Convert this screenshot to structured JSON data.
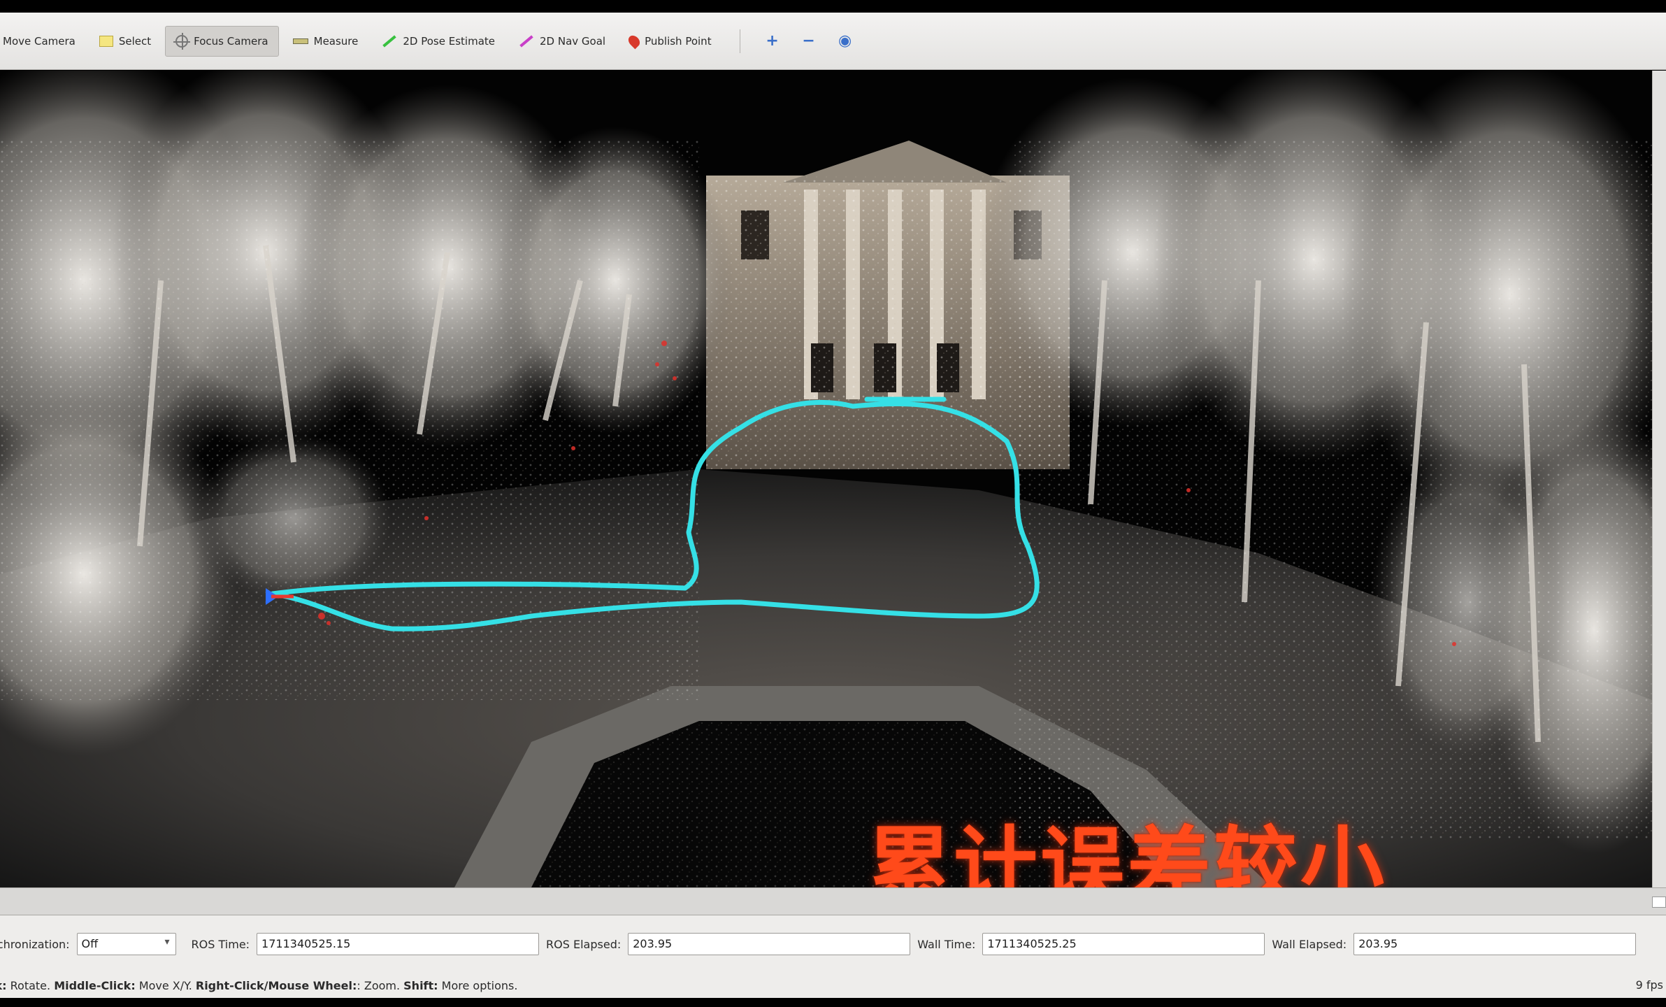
{
  "toolbar": {
    "tools": [
      {
        "label": "Move Camera",
        "icon": "move-camera-icon"
      },
      {
        "label": "Select",
        "icon": "select-icon"
      },
      {
        "label": "Focus Camera",
        "icon": "focus-camera-icon",
        "active": true
      },
      {
        "label": "Measure",
        "icon": "measure-icon"
      },
      {
        "label": "2D Pose Estimate",
        "icon": "pose-arrow-icon"
      },
      {
        "label": "2D Nav Goal",
        "icon": "nav-goal-arrow-icon"
      },
      {
        "label": "Publish Point",
        "icon": "publish-point-pin-icon"
      }
    ],
    "extra_icons": [
      "add-tool-icon",
      "remove-tool-icon",
      "camera-type-icon"
    ]
  },
  "viewport": {
    "overlay_caption": "累计误差较小",
    "trajectory_color": "#35e0e6"
  },
  "timebar": {
    "sync_label": "Synchronization:",
    "sync_value": "Off",
    "ros_time_label": "ROS Time:",
    "ros_time_value": "1711340525.15",
    "ros_elapsed_label": "ROS Elapsed:",
    "ros_elapsed_value": "203.95",
    "wall_time_label": "Wall Time:",
    "wall_time_value": "1711340525.25",
    "wall_elapsed_label": "Wall Elapsed:",
    "wall_elapsed_value": "203.95"
  },
  "statusbar": {
    "left_click": "Left-Click:",
    "left_action": "Rotate.",
    "middle_click": "Middle-Click:",
    "middle_action": "Move X/Y.",
    "right_click": "Right-Click/Mouse Wheel:",
    "right_action": ": Zoom.",
    "shift": "Shift:",
    "shift_action": "More options.",
    "fps": "9 fps"
  }
}
